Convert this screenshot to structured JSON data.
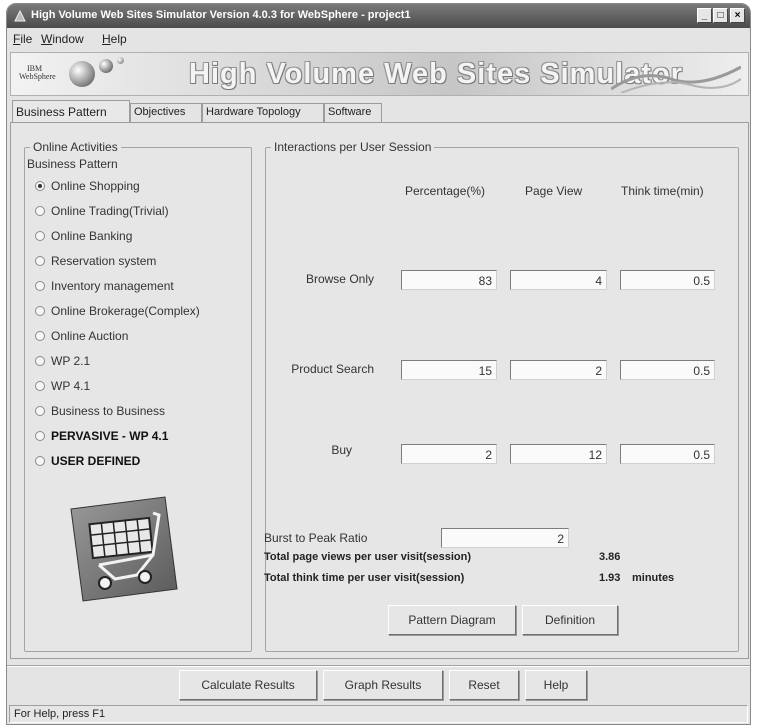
{
  "window": {
    "title": "High Volume Web Sites Simulator Version 4.0.3 for WebSphere - project1",
    "controls": {
      "minimize": "_",
      "maximize": "□",
      "close": "×"
    }
  },
  "menu": [
    "File",
    "Window",
    "Help"
  ],
  "banner": {
    "logo_top": "IBM",
    "logo_bottom": "WebSphere",
    "title": "High Volume Web Sites Simulator"
  },
  "tabs": [
    {
      "label": "Business Pattern",
      "active": true
    },
    {
      "label": "Objectives",
      "active": false
    },
    {
      "label": "Hardware Topology",
      "active": false
    },
    {
      "label": "Software",
      "active": false
    }
  ],
  "online_activities": {
    "legend": "Online Activities",
    "sublabel": "Business Pattern",
    "options": [
      {
        "label": "Online Shopping",
        "checked": true,
        "bold": false
      },
      {
        "label": "Online Trading(Trivial)",
        "checked": false,
        "bold": false
      },
      {
        "label": "Online Banking",
        "checked": false,
        "bold": false
      },
      {
        "label": "Reservation system",
        "checked": false,
        "bold": false
      },
      {
        "label": "Inventory management",
        "checked": false,
        "bold": false
      },
      {
        "label": "Online Brokerage(Complex)",
        "checked": false,
        "bold": false
      },
      {
        "label": "Online Auction",
        "checked": false,
        "bold": false
      },
      {
        "label": "WP 2.1",
        "checked": false,
        "bold": false
      },
      {
        "label": "WP 4.1",
        "checked": false,
        "bold": false
      },
      {
        "label": "Business to Business",
        "checked": false,
        "bold": false
      },
      {
        "label": "PERVASIVE - WP 4.1",
        "checked": false,
        "bold": true
      },
      {
        "label": "USER DEFINED",
        "checked": false,
        "bold": true
      }
    ],
    "icon": "shopping-cart-icon"
  },
  "interactions": {
    "legend": "Interactions per User Session",
    "columns": [
      "Percentage(%)",
      "Page View",
      "Think time(min)"
    ],
    "rows": [
      {
        "label": "Browse Only",
        "values": [
          "83",
          "4",
          "0.5"
        ]
      },
      {
        "label": "Product Search",
        "values": [
          "15",
          "2",
          "0.5"
        ]
      },
      {
        "label": "Buy",
        "values": [
          "2",
          "12",
          "0.5"
        ]
      }
    ],
    "burst_label": "Burst to Peak Ratio",
    "burst_value": "2",
    "total_page_views_label": "Total page views per user visit(session)",
    "total_page_views_value": "3.86",
    "total_think_label": "Total think time per user visit(session)",
    "total_think_value": "1.93",
    "total_think_unit": "minutes",
    "buttons": {
      "pattern_diagram": "Pattern Diagram",
      "definition": "Definition"
    }
  },
  "bottom_buttons": {
    "calculate": "Calculate Results",
    "graph": "Graph Results",
    "reset": "Reset",
    "help": "Help"
  },
  "status": "For Help, press F1",
  "colors": {
    "titlebar": "#4b4b4b",
    "background": "#e4e4e4"
  }
}
